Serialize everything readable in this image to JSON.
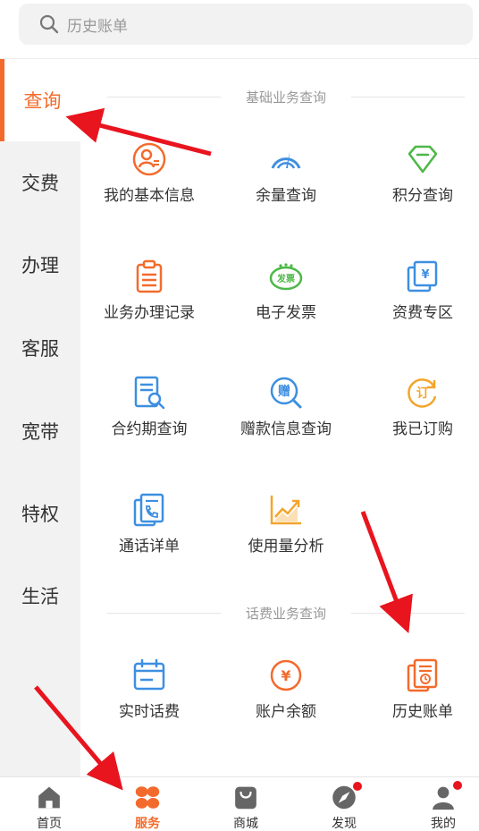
{
  "search": {
    "placeholder": "历史账单"
  },
  "sidebar": {
    "items": [
      {
        "label": "查询",
        "active": true
      },
      {
        "label": "交费"
      },
      {
        "label": "办理"
      },
      {
        "label": "客服"
      },
      {
        "label": "宽带"
      },
      {
        "label": "特权"
      },
      {
        "label": "生活"
      }
    ]
  },
  "sections": {
    "basic": {
      "title": "基础业务查询",
      "tiles": [
        {
          "label": "我的基本信息",
          "icon": "user-info-icon"
        },
        {
          "label": "余量查询",
          "icon": "gauge-icon"
        },
        {
          "label": "积分查询",
          "icon": "diamond-icon"
        },
        {
          "label": "业务办理记录",
          "icon": "clipboard-icon"
        },
        {
          "label": "电子发票",
          "icon": "invoice-icon",
          "icon_text": "发票"
        },
        {
          "label": "资费专区",
          "icon": "tariff-icon",
          "icon_text": "¥"
        },
        {
          "label": "合约期查询",
          "icon": "contract-search-icon"
        },
        {
          "label": "赠款信息查询",
          "icon": "gift-search-icon",
          "icon_text": "赠"
        },
        {
          "label": "我已订购",
          "icon": "subscribed-icon",
          "icon_text": "订"
        },
        {
          "label": "通话详单",
          "icon": "call-detail-icon"
        },
        {
          "label": "使用量分析",
          "icon": "usage-chart-icon"
        }
      ]
    },
    "fee": {
      "title": "话费业务查询",
      "tiles": [
        {
          "label": "实时话费",
          "icon": "calendar-icon"
        },
        {
          "label": "账户余额",
          "icon": "balance-icon",
          "icon_text": "¥"
        },
        {
          "label": "历史账单",
          "icon": "history-bill-icon"
        }
      ]
    }
  },
  "tabbar": {
    "items": [
      {
        "label": "首页",
        "icon": "home-icon"
      },
      {
        "label": "服务",
        "icon": "service-icon",
        "active": true
      },
      {
        "label": "商城",
        "icon": "bag-icon"
      },
      {
        "label": "发现",
        "icon": "compass-icon",
        "badge": true
      },
      {
        "label": "我的",
        "icon": "user-icon",
        "badge": true
      }
    ]
  },
  "colors": {
    "accent": "#f36b2c",
    "blue": "#3d8fe0",
    "green": "#4cb847",
    "orange": "#f38a2c",
    "badge": "#e8141e",
    "arrow": "#e8141e"
  }
}
